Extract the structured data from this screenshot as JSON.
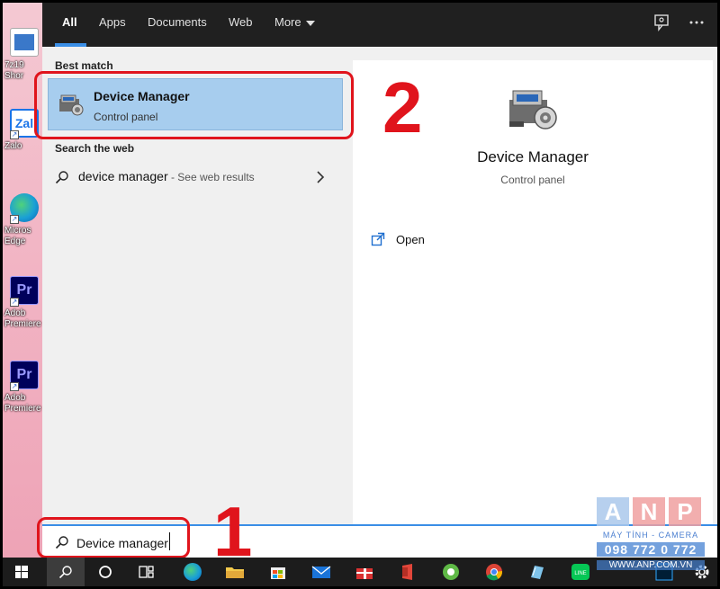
{
  "colors": {
    "accent": "#3a8ee6",
    "selection": "#a7cdee",
    "annotation": "#e0141c",
    "topbar": "#202020"
  },
  "desktop": {
    "icons": [
      {
        "label": "7z19...\nShor...",
        "icon": "file-icon"
      },
      {
        "label": "Zalo",
        "icon": "zalo-icon"
      },
      {
        "label": "Micros...\nEdge",
        "icon": "edge-icon"
      },
      {
        "label": "Adob...\nPremiere",
        "icon": "premiere-icon"
      },
      {
        "label": "Adob...\nPremiere",
        "icon": "premiere-icon"
      }
    ]
  },
  "desktop_labels": {
    "i0a": "7z19",
    "i0b": "Shor",
    "i1a": "Zalo",
    "i1icon": "Zal",
    "i2a": "Micros",
    "i2b": "Edge",
    "i3icon": "Pr",
    "i3a": "Adob",
    "i3b": "Premiere",
    "i4icon": "Pr",
    "i4a": "Adob",
    "i4b": "Premiere"
  },
  "topbar": {
    "tabs": [
      "All",
      "Apps",
      "Documents",
      "Web",
      "More"
    ],
    "active_tab": "All"
  },
  "results": {
    "best_match_header": "Best match",
    "best_match": {
      "title": "Device Manager",
      "subtitle": "Control panel"
    },
    "web_header": "Search the web",
    "web_item": {
      "query": "device manager",
      "hint": " - See web results"
    }
  },
  "preview": {
    "title": "Device Manager",
    "subtitle": "Control panel",
    "action_open": "Open"
  },
  "search": {
    "value": "Device manager"
  },
  "annotations": {
    "step1": "1",
    "step2": "2"
  },
  "watermark": {
    "letters": [
      "A",
      "N",
      "P"
    ],
    "tagline": "MÁY TÍNH - CAMERA",
    "phone": "098 772 0 772",
    "site": "WWW.ANP.COM.VN"
  }
}
